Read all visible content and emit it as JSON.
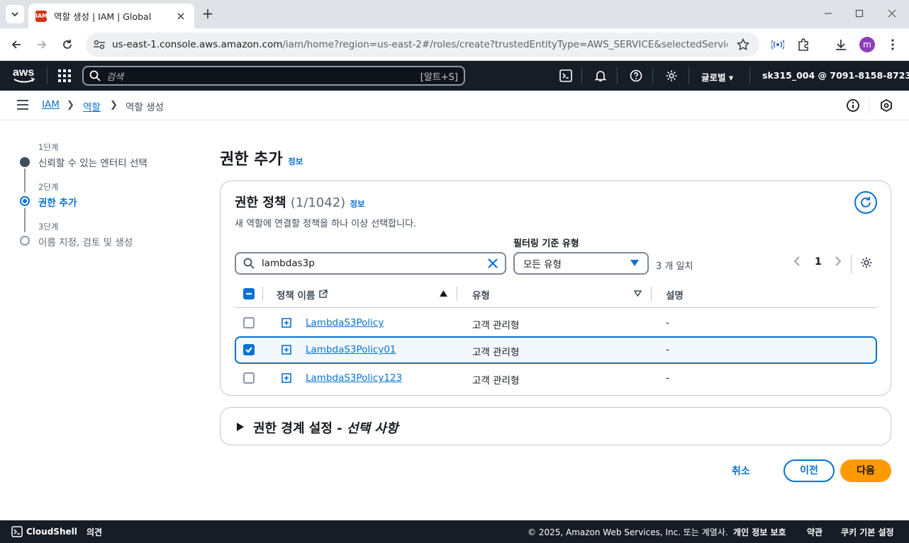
{
  "browser": {
    "tab_title": "역할 생성 | IAM | Global",
    "url_host": "us-east-1.console.aws.amazon.com",
    "url_rest": "/iam/home?region=us-east-2#/roles/create?trustedEntityType=AWS_SERVICE&selectedService=Lam...",
    "profile_initial": "m"
  },
  "aws_nav": {
    "logo_text": "aws",
    "search_placeholder": "검색",
    "search_shortcut": "[알트+S]",
    "region": "글로벌",
    "account": "sk315_004 @ 7091-8158-8723"
  },
  "breadcrumb": [
    "IAM",
    "역할",
    "역할 생성"
  ],
  "steps": [
    {
      "num": "1단계",
      "name": "신뢰할 수 있는 엔터티 선택",
      "state": "done"
    },
    {
      "num": "2단계",
      "name": "권한 추가",
      "state": "current"
    },
    {
      "num": "3단계",
      "name": "이름 지정, 검토 및 생성",
      "state": "pending"
    }
  ],
  "page": {
    "title": "권한 추가",
    "info": "정보"
  },
  "policies": {
    "title": "권한 정책",
    "count": "(1/1042)",
    "info": "정보",
    "description": "새 역할에 연결할 정책을 하나 이상 선택합니다.",
    "filter_label": "필터링 기준 유형",
    "search_value": "lambdas3p",
    "filter_value": "모든 유형",
    "match_count": "3 개 일치",
    "page": "1",
    "columns": {
      "name": "정책 이름",
      "type": "유형",
      "desc": "설명"
    },
    "rows": [
      {
        "name": "LambdaS3Policy",
        "type": "고객 관리형",
        "desc": "-",
        "checked": false
      },
      {
        "name": "LambdaS3Policy01",
        "type": "고객 관리형",
        "desc": "-",
        "checked": true
      },
      {
        "name": "LambdaS3Policy123",
        "type": "고객 관리형",
        "desc": "-",
        "checked": false
      }
    ]
  },
  "boundary": {
    "title": "권한 경계 설정 - ",
    "optional": "선택 사항"
  },
  "actions": {
    "cancel": "취소",
    "previous": "이전",
    "next": "다음"
  },
  "footer": {
    "cloudshell": "CloudShell",
    "feedback": "의견",
    "copyright": "© 2025, Amazon Web Services, Inc. 또는 계열사.",
    "privacy": "개인 정보 보호",
    "terms": "약관",
    "cookies": "쿠키 기본 설정"
  },
  "colors": {
    "accent": "#0972d3",
    "primary_button": "#ff9900",
    "nav_bg": "#161d26"
  }
}
